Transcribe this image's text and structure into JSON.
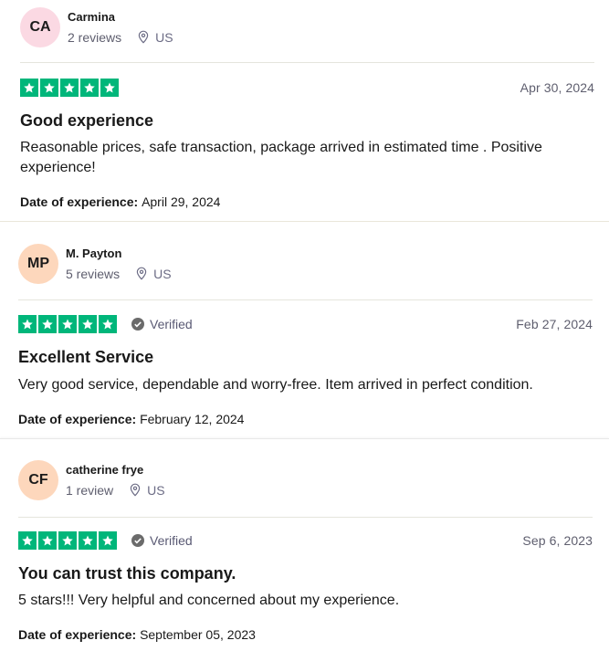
{
  "colors": {
    "star_green": "#00b67a",
    "avatar_pink": "#fbd9e3",
    "avatar_peach": "#fdd7bc"
  },
  "reviews": [
    {
      "initials": "CA",
      "name": "Carmina",
      "review_count": "2 reviews",
      "location": "US",
      "rating": 5,
      "verified": "",
      "date": "Apr 30, 2024",
      "title": "Good experience",
      "text": "Reasonable prices, safe transaction, package arrived in estimated time . Positive experience!",
      "experience_label": "Date of experience:",
      "experience_date": "April 29, 2024"
    },
    {
      "initials": "MP",
      "name": "M. Payton",
      "review_count": "5 reviews",
      "location": "US",
      "rating": 5,
      "verified": "Verified",
      "date": "Feb 27, 2024",
      "title": "Excellent Service",
      "text": "Very good service, dependable and worry-free. Item arrived in perfect condition.",
      "experience_label": "Date of experience:",
      "experience_date": "February 12, 2024"
    },
    {
      "initials": "CF",
      "name": "catherine frye",
      "review_count": "1 review",
      "location": "US",
      "rating": 5,
      "verified": "Verified",
      "date": "Sep 6, 2023",
      "title": "You can trust this company.",
      "text": "5 stars!!! Very helpful and concerned about my experience.",
      "experience_label": "Date of experience:",
      "experience_date": "September 05, 2023"
    }
  ]
}
